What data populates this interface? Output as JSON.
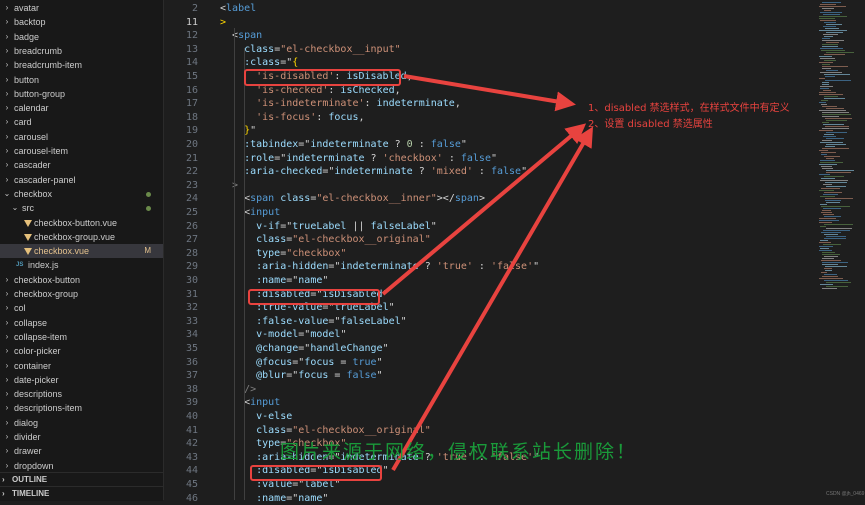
{
  "sidebar": {
    "items": [
      {
        "label": "avatar",
        "kind": "folder"
      },
      {
        "label": "backtop",
        "kind": "folder"
      },
      {
        "label": "badge",
        "kind": "folder"
      },
      {
        "label": "breadcrumb",
        "kind": "folder"
      },
      {
        "label": "breadcrumb-item",
        "kind": "folder"
      },
      {
        "label": "button",
        "kind": "folder"
      },
      {
        "label": "button-group",
        "kind": "folder"
      },
      {
        "label": "calendar",
        "kind": "folder"
      },
      {
        "label": "card",
        "kind": "folder"
      },
      {
        "label": "carousel",
        "kind": "folder"
      },
      {
        "label": "carousel-item",
        "kind": "folder"
      },
      {
        "label": "cascader",
        "kind": "folder"
      },
      {
        "label": "cascader-panel",
        "kind": "folder"
      },
      {
        "label": "checkbox",
        "kind": "folder-open"
      },
      {
        "label": "src",
        "kind": "folder-open-child"
      },
      {
        "label": "checkbox-button.vue",
        "kind": "vue"
      },
      {
        "label": "checkbox-group.vue",
        "kind": "vue"
      },
      {
        "label": "checkbox.vue",
        "kind": "vue-active"
      },
      {
        "label": "index.js",
        "kind": "js"
      },
      {
        "label": "checkbox-button",
        "kind": "folder"
      },
      {
        "label": "checkbox-group",
        "kind": "folder"
      },
      {
        "label": "col",
        "kind": "folder"
      },
      {
        "label": "collapse",
        "kind": "folder"
      },
      {
        "label": "collapse-item",
        "kind": "folder"
      },
      {
        "label": "color-picker",
        "kind": "folder"
      },
      {
        "label": "container",
        "kind": "folder"
      },
      {
        "label": "date-picker",
        "kind": "folder"
      },
      {
        "label": "descriptions",
        "kind": "folder"
      },
      {
        "label": "descriptions-item",
        "kind": "folder"
      },
      {
        "label": "dialog",
        "kind": "folder"
      },
      {
        "label": "divider",
        "kind": "folder"
      },
      {
        "label": "drawer",
        "kind": "folder"
      },
      {
        "label": "dropdown",
        "kind": "folder"
      }
    ],
    "modified_badge": "M",
    "outline_label": "OUTLINE",
    "timeline_label": "TIMELINE"
  },
  "editor": {
    "line_numbers": [
      "2",
      "11",
      "12",
      "13",
      "14",
      "15",
      "16",
      "17",
      "18",
      "19",
      "20",
      "21",
      "22",
      "23",
      "24",
      "25",
      "26",
      "27",
      "28",
      "29",
      "30",
      "31",
      "32",
      "33",
      "34",
      "35",
      "36",
      "37",
      "38",
      "39",
      "40",
      "41",
      "42",
      "43",
      "44",
      "45",
      "46"
    ],
    "current_line": "11",
    "lines": [
      [
        [
          "t-op",
          "<"
        ],
        [
          "t-tag",
          "label"
        ]
      ],
      [
        [
          "t-yel",
          ">"
        ]
      ],
      [
        [
          "t-op",
          "  <"
        ],
        [
          "t-tag",
          "span"
        ]
      ],
      [
        [
          "t-attr",
          "    class"
        ],
        [
          "t-op",
          "="
        ],
        [
          "t-str",
          "\"el-checkbox__input\""
        ]
      ],
      [
        [
          "t-attr",
          "    :class"
        ],
        [
          "t-op",
          "=\""
        ],
        [
          "t-yel",
          "{"
        ]
      ],
      [
        [
          "t-str",
          "      'is-disabled'"
        ],
        [
          "t-op",
          ": "
        ],
        [
          "t-var",
          "isDisabled"
        ],
        [
          "t-op",
          ","
        ]
      ],
      [
        [
          "t-str",
          "      'is-checked'"
        ],
        [
          "t-op",
          ": "
        ],
        [
          "t-var",
          "isChecked"
        ],
        [
          "t-op",
          ","
        ]
      ],
      [
        [
          "t-str",
          "      'is-indeterminate'"
        ],
        [
          "t-op",
          ": "
        ],
        [
          "t-var",
          "indeterminate"
        ],
        [
          "t-op",
          ","
        ]
      ],
      [
        [
          "t-str",
          "      'is-focus'"
        ],
        [
          "t-op",
          ": "
        ],
        [
          "t-var",
          "focus"
        ],
        [
          "t-op",
          ","
        ]
      ],
      [
        [
          "t-yel",
          "    }"
        ],
        [
          "t-op",
          "\""
        ]
      ],
      [
        [
          "t-attr",
          "    :tabindex"
        ],
        [
          "t-op",
          "=\""
        ],
        [
          "t-var",
          "indeterminate"
        ],
        [
          "t-op",
          " ? "
        ],
        [
          "t-num",
          "0"
        ],
        [
          "t-op",
          " : "
        ],
        [
          "t-bool",
          "false"
        ],
        [
          "t-op",
          "\""
        ]
      ],
      [
        [
          "t-attr",
          "    :role"
        ],
        [
          "t-op",
          "=\""
        ],
        [
          "t-var",
          "indeterminate"
        ],
        [
          "t-op",
          " ? "
        ],
        [
          "t-str",
          "'checkbox'"
        ],
        [
          "t-op",
          " : "
        ],
        [
          "t-bool",
          "false"
        ],
        [
          "t-op",
          "\""
        ]
      ],
      [
        [
          "t-attr",
          "    :aria-checked"
        ],
        [
          "t-op",
          "=\""
        ],
        [
          "t-var",
          "indeterminate"
        ],
        [
          "t-op",
          " ? "
        ],
        [
          "t-str",
          "'mixed'"
        ],
        [
          "t-op",
          " : "
        ],
        [
          "t-bool",
          "false"
        ],
        [
          "t-op",
          "\""
        ]
      ],
      [
        [
          "t-br",
          "  >"
        ]
      ],
      [
        [
          "t-op",
          "    <"
        ],
        [
          "t-tag",
          "span"
        ],
        [
          "t-attr",
          " class"
        ],
        [
          "t-op",
          "="
        ],
        [
          "t-str",
          "\"el-checkbox__inner\""
        ],
        [
          "t-op",
          "></"
        ],
        [
          "t-tag",
          "span"
        ],
        [
          "t-op",
          ">"
        ]
      ],
      [
        [
          "t-op",
          "    <"
        ],
        [
          "t-tag",
          "input"
        ]
      ],
      [
        [
          "t-attr",
          "      v-if"
        ],
        [
          "t-op",
          "=\""
        ],
        [
          "t-var",
          "trueLabel"
        ],
        [
          "t-op",
          " || "
        ],
        [
          "t-var",
          "falseLabel"
        ],
        [
          "t-op",
          "\""
        ]
      ],
      [
        [
          "t-attr",
          "      class"
        ],
        [
          "t-op",
          "="
        ],
        [
          "t-str",
          "\"el-checkbox__original\""
        ]
      ],
      [
        [
          "t-attr",
          "      type"
        ],
        [
          "t-op",
          "="
        ],
        [
          "t-str",
          "\"checkbox\""
        ]
      ],
      [
        [
          "t-attr",
          "      :aria-hidden"
        ],
        [
          "t-op",
          "=\""
        ],
        [
          "t-var",
          "indeterminate"
        ],
        [
          "t-op",
          " ? "
        ],
        [
          "t-str",
          "'true'"
        ],
        [
          "t-op",
          " : "
        ],
        [
          "t-str",
          "'false'"
        ],
        [
          "t-op",
          "\""
        ]
      ],
      [
        [
          "t-attr",
          "      :name"
        ],
        [
          "t-op",
          "=\""
        ],
        [
          "t-var",
          "name"
        ],
        [
          "t-op",
          "\""
        ]
      ],
      [
        [
          "t-attr",
          "      :disabled"
        ],
        [
          "t-op",
          "=\""
        ],
        [
          "t-var",
          "isDisabled"
        ],
        [
          "t-op",
          "\""
        ]
      ],
      [
        [
          "t-attr",
          "      :true-value"
        ],
        [
          "t-op",
          "=\""
        ],
        [
          "t-var",
          "trueLabel"
        ],
        [
          "t-op",
          "\""
        ]
      ],
      [
        [
          "t-attr",
          "      :false-value"
        ],
        [
          "t-op",
          "=\""
        ],
        [
          "t-var",
          "falseLabel"
        ],
        [
          "t-op",
          "\""
        ]
      ],
      [
        [
          "t-attr",
          "      v-model"
        ],
        [
          "t-op",
          "=\""
        ],
        [
          "t-var",
          "model"
        ],
        [
          "t-op",
          "\""
        ]
      ],
      [
        [
          "t-attr",
          "      @change"
        ],
        [
          "t-op",
          "=\""
        ],
        [
          "t-var",
          "handleChange"
        ],
        [
          "t-op",
          "\""
        ]
      ],
      [
        [
          "t-attr",
          "      @focus"
        ],
        [
          "t-op",
          "=\""
        ],
        [
          "t-var",
          "focus"
        ],
        [
          "t-op",
          " = "
        ],
        [
          "t-bool",
          "true"
        ],
        [
          "t-op",
          "\""
        ]
      ],
      [
        [
          "t-attr",
          "      @blur"
        ],
        [
          "t-op",
          "=\""
        ],
        [
          "t-var",
          "focus"
        ],
        [
          "t-op",
          " = "
        ],
        [
          "t-bool",
          "false"
        ],
        [
          "t-op",
          "\""
        ]
      ],
      [
        [
          "t-br",
          "    />"
        ]
      ],
      [
        [
          "t-op",
          "    <"
        ],
        [
          "t-tag",
          "input"
        ]
      ],
      [
        [
          "t-attr",
          "      v-else"
        ]
      ],
      [
        [
          "t-attr",
          "      class"
        ],
        [
          "t-op",
          "="
        ],
        [
          "t-str",
          "\"el-checkbox__original\""
        ]
      ],
      [
        [
          "t-attr",
          "      type"
        ],
        [
          "t-op",
          "="
        ],
        [
          "t-str",
          "\"checkbox\""
        ]
      ],
      [
        [
          "t-attr",
          "      :aria-hidden"
        ],
        [
          "t-op",
          "=\""
        ],
        [
          "t-var",
          "indeterminate"
        ],
        [
          "t-op",
          " ? "
        ],
        [
          "t-str",
          "'true'"
        ],
        [
          "t-op",
          " : "
        ],
        [
          "t-str",
          "'false'"
        ],
        [
          "t-op",
          "\""
        ]
      ],
      [
        [
          "t-attr",
          "      :disabled"
        ],
        [
          "t-op",
          "=\""
        ],
        [
          "t-var",
          "isDisabled"
        ],
        [
          "t-op",
          "\""
        ]
      ],
      [
        [
          "t-attr",
          "      :value"
        ],
        [
          "t-op",
          "=\""
        ],
        [
          "t-var",
          "label"
        ],
        [
          "t-op",
          "\""
        ]
      ],
      [
        [
          "t-attr",
          "      :name"
        ],
        [
          "t-op",
          "=\""
        ],
        [
          "t-var",
          "name"
        ],
        [
          "t-op",
          "\""
        ]
      ]
    ]
  },
  "annotation": {
    "line1": "1、disabled 禁选样式，在样式文件中有定义",
    "line2": "2、设置 disabled 禁选属性",
    "color": "#e8433f"
  },
  "watermark": "图片来源于网络，侵权联系站长删除！",
  "csdn_mark": "CSDN @jh_0469"
}
